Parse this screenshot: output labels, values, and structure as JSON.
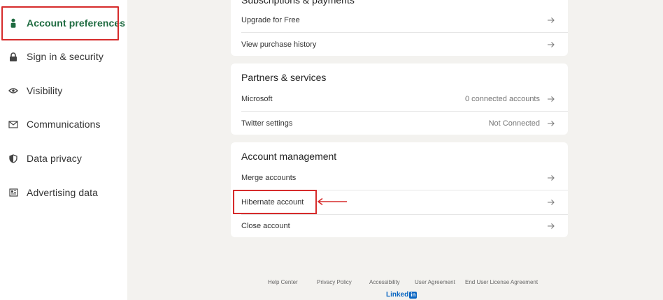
{
  "sidebar": {
    "items": [
      {
        "label": "Account preferences",
        "icon": "person-icon"
      },
      {
        "label": "Sign in & security",
        "icon": "lock-icon"
      },
      {
        "label": "Visibility",
        "icon": "eye-icon"
      },
      {
        "label": "Communications",
        "icon": "envelope-icon"
      },
      {
        "label": "Data privacy",
        "icon": "shield-icon"
      },
      {
        "label": "Advertising data",
        "icon": "newspaper-icon"
      }
    ]
  },
  "subscriptions": {
    "title": "Subscriptions & payments",
    "rows": [
      {
        "label": "Upgrade for Free",
        "value": ""
      },
      {
        "label": "View purchase history",
        "value": ""
      }
    ]
  },
  "partners": {
    "title": "Partners & services",
    "rows": [
      {
        "label": "Microsoft",
        "value": "0 connected accounts"
      },
      {
        "label": "Twitter settings",
        "value": "Not Connected"
      }
    ]
  },
  "account_management": {
    "title": "Account management",
    "rows": [
      {
        "label": "Merge accounts",
        "value": ""
      },
      {
        "label": "Hibernate account",
        "value": ""
      },
      {
        "label": "Close account",
        "value": ""
      }
    ]
  },
  "footer": {
    "links": [
      "Help Center",
      "Privacy Policy",
      "Accessibility",
      "User Agreement",
      "End User License Agreement"
    ],
    "logo_text": "Linked",
    "logo_badge": "in"
  },
  "colors": {
    "accent_green": "#1e6b40",
    "annotation_red": "#d62b2b",
    "brand_blue": "#0a66c2"
  }
}
